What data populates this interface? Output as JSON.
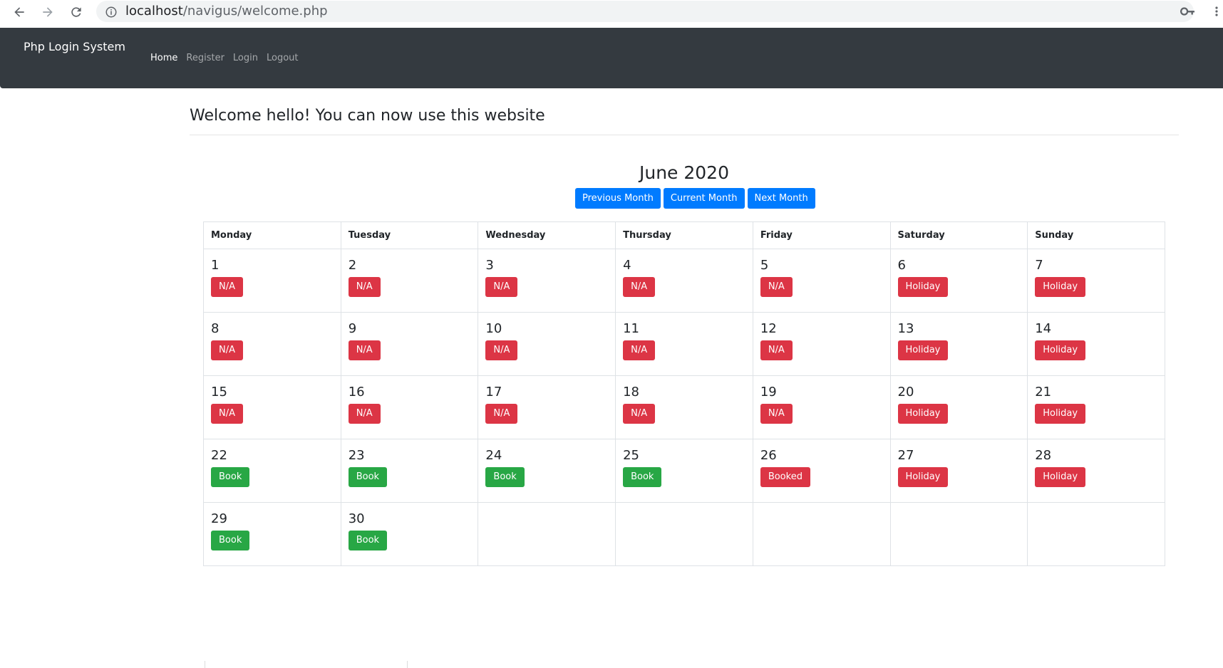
{
  "browser": {
    "url_host": "localhost",
    "url_path": "/navigus/welcome.php"
  },
  "navbar": {
    "brand": "Php Login System",
    "links": [
      {
        "label": "Home",
        "active": true
      },
      {
        "label": "Register",
        "active": false
      },
      {
        "label": "Login",
        "active": false
      },
      {
        "label": "Logout",
        "active": false
      }
    ]
  },
  "welcome": "Welcome hello! You can now use this website",
  "calendar": {
    "title": "June 2020",
    "nav": {
      "previous": "Previous Month",
      "current": "Current Month",
      "next": "Next Month"
    },
    "weekdays": [
      "Monday",
      "Tuesday",
      "Wednesday",
      "Thursday",
      "Friday",
      "Saturday",
      "Sunday"
    ],
    "weeks": [
      [
        {
          "day": "1",
          "label": "N/A",
          "status": "na"
        },
        {
          "day": "2",
          "label": "N/A",
          "status": "na"
        },
        {
          "day": "3",
          "label": "N/A",
          "status": "na"
        },
        {
          "day": "4",
          "label": "N/A",
          "status": "na"
        },
        {
          "day": "5",
          "label": "N/A",
          "status": "na"
        },
        {
          "day": "6",
          "label": "Holiday",
          "status": "holiday"
        },
        {
          "day": "7",
          "label": "Holiday",
          "status": "holiday"
        }
      ],
      [
        {
          "day": "8",
          "label": "N/A",
          "status": "na"
        },
        {
          "day": "9",
          "label": "N/A",
          "status": "na"
        },
        {
          "day": "10",
          "label": "N/A",
          "status": "na"
        },
        {
          "day": "11",
          "label": "N/A",
          "status": "na"
        },
        {
          "day": "12",
          "label": "N/A",
          "status": "na"
        },
        {
          "day": "13",
          "label": "Holiday",
          "status": "holiday"
        },
        {
          "day": "14",
          "label": "Holiday",
          "status": "holiday"
        }
      ],
      [
        {
          "day": "15",
          "label": "N/A",
          "status": "na"
        },
        {
          "day": "16",
          "label": "N/A",
          "status": "na"
        },
        {
          "day": "17",
          "label": "N/A",
          "status": "na"
        },
        {
          "day": "18",
          "label": "N/A",
          "status": "na"
        },
        {
          "day": "19",
          "label": "N/A",
          "status": "na"
        },
        {
          "day": "20",
          "label": "Holiday",
          "status": "holiday"
        },
        {
          "day": "21",
          "label": "Holiday",
          "status": "holiday"
        }
      ],
      [
        {
          "day": "22",
          "label": "Book",
          "status": "book"
        },
        {
          "day": "23",
          "label": "Book",
          "status": "book"
        },
        {
          "day": "24",
          "label": "Book",
          "status": "book"
        },
        {
          "day": "25",
          "label": "Book",
          "status": "book"
        },
        {
          "day": "26",
          "label": "Booked",
          "status": "booked"
        },
        {
          "day": "27",
          "label": "Holiday",
          "status": "holiday"
        },
        {
          "day": "28",
          "label": "Holiday",
          "status": "holiday"
        }
      ],
      [
        {
          "day": "29",
          "label": "Book",
          "status": "book"
        },
        {
          "day": "30",
          "label": "Book",
          "status": "book"
        },
        null,
        null,
        null,
        null,
        null
      ]
    ]
  },
  "colors": {
    "navbar_bg": "#343a40",
    "primary": "#007bff",
    "danger": "#dc3545",
    "success": "#28a745"
  },
  "icons": {
    "back": "arrow-left-icon",
    "forward": "arrow-right-icon",
    "reload": "reload-icon",
    "site_info": "info-icon",
    "saved_password": "key-icon",
    "browser_menu": "kebab-menu-icon"
  }
}
